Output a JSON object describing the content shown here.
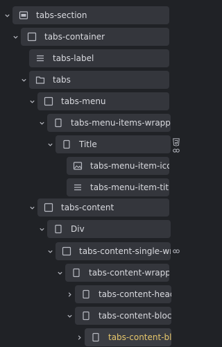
{
  "tree": {
    "items": [
      {
        "label": "tabs-section",
        "icon": "section-icon",
        "chevron": "down"
      },
      {
        "label": "tabs-container",
        "icon": "container-icon",
        "chevron": "down"
      },
      {
        "label": "tabs-label",
        "icon": "text-icon",
        "chevron": "none"
      },
      {
        "label": "tabs",
        "icon": "folder-icon",
        "chevron": "down"
      },
      {
        "label": "tabs-menu",
        "icon": "container-icon",
        "chevron": "down"
      },
      {
        "label": "tabs-menu-items-wrapper",
        "icon": "block-icon",
        "chevron": "down"
      },
      {
        "label": "Title",
        "icon": "block-icon",
        "chevron": "down"
      },
      {
        "label": "tabs-menu-item-icon",
        "icon": "image-icon",
        "chevron": "none"
      },
      {
        "label": "tabs-menu-item-title",
        "icon": "text-icon",
        "chevron": "none"
      },
      {
        "label": "tabs-content",
        "icon": "container-icon",
        "chevron": "down"
      },
      {
        "label": "Div",
        "icon": "block-icon",
        "chevron": "down"
      },
      {
        "label": "tabs-content-single-wrapper",
        "icon": "container-icon",
        "chevron": "down"
      },
      {
        "label": "tabs-content-wrapper",
        "icon": "block-icon",
        "chevron": "down"
      },
      {
        "label": "tabs-content-heading",
        "icon": "block-icon",
        "chevron": "right"
      },
      {
        "label": "tabs-content-blocks-wrapper",
        "icon": "block-icon",
        "chevron": "down"
      },
      {
        "label": "tabs-content-block",
        "icon": "block-icon",
        "chevron": "right"
      }
    ],
    "side_icons": {
      "html5": "html5-icon",
      "symbol_link": "symbol-link-icon",
      "symbol_link_2": "symbol-link-icon"
    },
    "colors": {
      "background": "#202226",
      "row_background": "#34363c",
      "text": "#d9dadf",
      "highlight_text": "#e6c66b"
    }
  }
}
